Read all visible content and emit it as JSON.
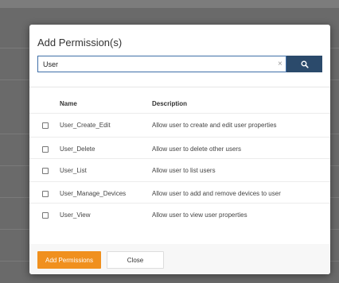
{
  "modal": {
    "title": "Add Permission(s)"
  },
  "search": {
    "value": "User",
    "clear_glyph": "×",
    "icon": "search-icon"
  },
  "table": {
    "headers": {
      "name": "Name",
      "description": "Description"
    },
    "rows": [
      {
        "name": "User_Create_Edit",
        "description": "Allow user to create and edit user properties"
      },
      {
        "name": "User_Delete",
        "description": "Allow user to delete other users"
      },
      {
        "name": "User_List",
        "description": "Allow user to list users"
      },
      {
        "name": "User_Manage_Devices",
        "description": "Allow user to add and remove devices to user"
      },
      {
        "name": "User_View",
        "description": "Allow user to view user properties"
      }
    ]
  },
  "footer": {
    "add_label": "Add Permissions",
    "close_label": "Close"
  },
  "colors": {
    "primary_button": "#f0901e",
    "search_button": "#2b4a6b",
    "input_border": "#3f6fa8"
  }
}
